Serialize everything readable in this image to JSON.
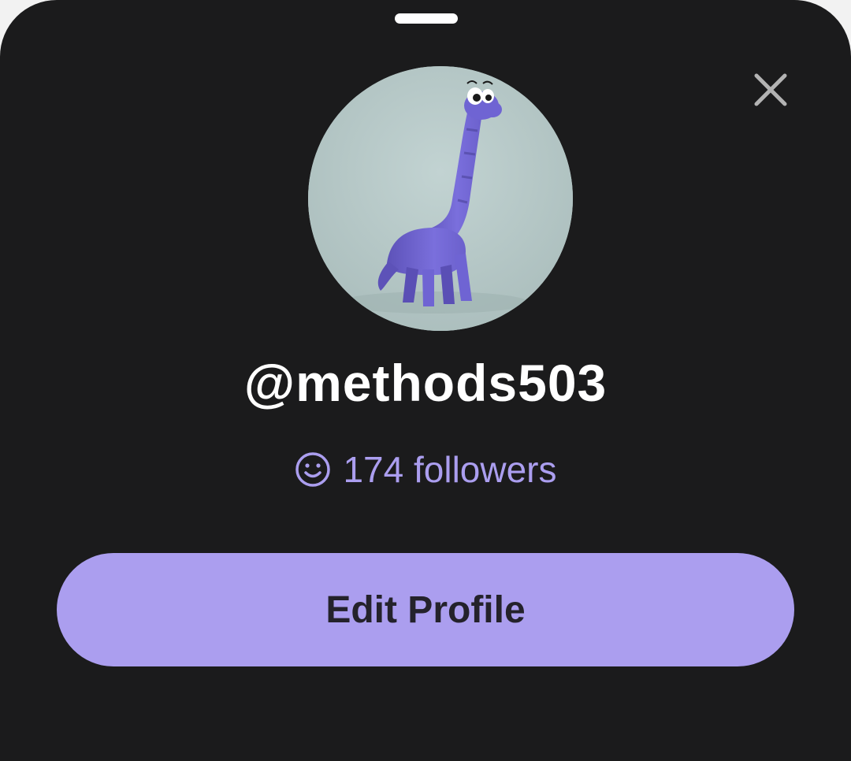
{
  "profile": {
    "username": "@methods503",
    "followers_label": "174 followers",
    "followers_count": 174,
    "avatar_icon": "purple-clay-dinosaur-avatar"
  },
  "actions": {
    "edit_profile_label": "Edit Profile",
    "close_icon": "close-icon"
  },
  "icons": {
    "followers": "smile-icon"
  },
  "colors": {
    "background": "#1b1b1c",
    "accent": "#ab9eef",
    "button_text": "#24222b",
    "text_primary": "#ffffff",
    "close_icon": "#b3b3b3"
  }
}
